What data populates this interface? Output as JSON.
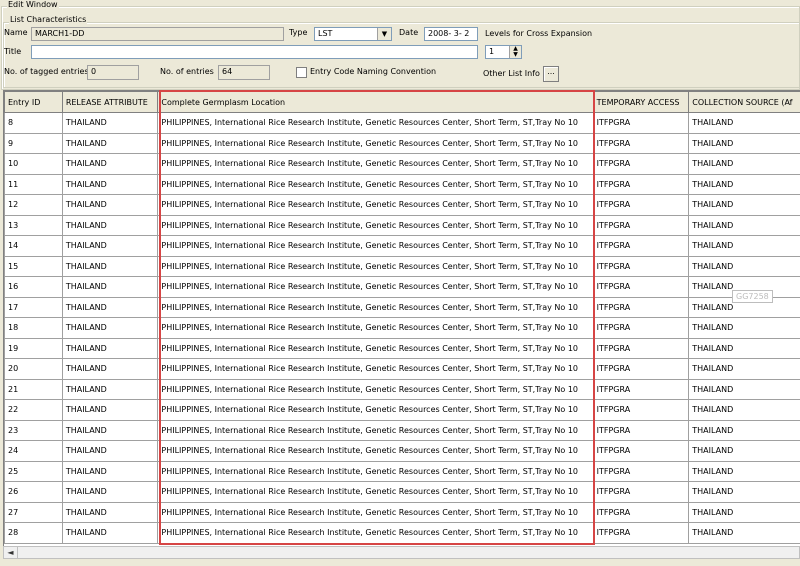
{
  "window": {
    "title": "Edit Window",
    "group_title": "List Characteristics"
  },
  "form": {
    "name_label": "Name",
    "name_value": "MARCH1-DD",
    "type_label": "Type",
    "type_value": "LST",
    "date_label": "Date",
    "date_value": "2008- 3- 2",
    "levels_label": "Levels for Cross Expansion",
    "levels_value": "1",
    "title_label": "Title",
    "title_value": "",
    "tagged_label": "No. of tagged entries",
    "tagged_value": "0",
    "entries_label": "No. of entries",
    "entries_value": "64",
    "naming_label": "Entry Code Naming Convention",
    "other_info_label": "Other List Info",
    "other_info_button": "..."
  },
  "table": {
    "columns": [
      "Entry ID",
      "RELEASE ATTRIBUTE",
      "Complete Germplasm Location",
      "TEMPORARY ACCESS",
      "COLLECTION SOURCE (Af"
    ],
    "rows": [
      [
        "8",
        "THAILAND",
        "PHILIPPINES, International Rice Research Institute, Genetic Resources Center, Short Term, ST,Tray No 10",
        "ITFPGRA",
        "THAILAND"
      ],
      [
        "9",
        "THAILAND",
        "PHILIPPINES, International Rice Research Institute, Genetic Resources Center, Short Term, ST,Tray No 10",
        "ITFPGRA",
        "THAILAND"
      ],
      [
        "10",
        "THAILAND",
        "PHILIPPINES, International Rice Research Institute, Genetic Resources Center, Short Term, ST,Tray No 10",
        "ITFPGRA",
        "THAILAND"
      ],
      [
        "11",
        "THAILAND",
        "PHILIPPINES, International Rice Research Institute, Genetic Resources Center, Short Term, ST,Tray No 10",
        "ITFPGRA",
        "THAILAND"
      ],
      [
        "12",
        "THAILAND",
        "PHILIPPINES, International Rice Research Institute, Genetic Resources Center, Short Term, ST,Tray No 10",
        "ITFPGRA",
        "THAILAND"
      ],
      [
        "13",
        "THAILAND",
        "PHILIPPINES, International Rice Research Institute, Genetic Resources Center, Short Term, ST,Tray No 10",
        "ITFPGRA",
        "THAILAND"
      ],
      [
        "14",
        "THAILAND",
        "PHILIPPINES, International Rice Research Institute, Genetic Resources Center, Short Term, ST,Tray No 10",
        "ITFPGRA",
        "THAILAND"
      ],
      [
        "15",
        "THAILAND",
        "PHILIPPINES, International Rice Research Institute, Genetic Resources Center, Short Term, ST,Tray No 10",
        "ITFPGRA",
        "THAILAND"
      ],
      [
        "16",
        "THAILAND",
        "PHILIPPINES, International Rice Research Institute, Genetic Resources Center, Short Term, ST,Tray No 10",
        "ITFPGRA",
        "THAILAND"
      ],
      [
        "17",
        "THAILAND",
        "PHILIPPINES, International Rice Research Institute, Genetic Resources Center, Short Term, ST,Tray No 10",
        "ITFPGRA",
        "THAILAND"
      ],
      [
        "18",
        "THAILAND",
        "PHILIPPINES, International Rice Research Institute, Genetic Resources Center, Short Term, ST,Tray No 10",
        "ITFPGRA",
        "THAILAND"
      ],
      [
        "19",
        "THAILAND",
        "PHILIPPINES, International Rice Research Institute, Genetic Resources Center, Short Term, ST,Tray No 10",
        "ITFPGRA",
        "THAILAND"
      ],
      [
        "20",
        "THAILAND",
        "PHILIPPINES, International Rice Research Institute, Genetic Resources Center, Short Term, ST,Tray No 10",
        "ITFPGRA",
        "THAILAND"
      ],
      [
        "21",
        "THAILAND",
        "PHILIPPINES, International Rice Research Institute, Genetic Resources Center, Short Term, ST,Tray No 10",
        "ITFPGRA",
        "THAILAND"
      ],
      [
        "22",
        "THAILAND",
        "PHILIPPINES, International Rice Research Institute, Genetic Resources Center, Short Term, ST,Tray No 10",
        "ITFPGRA",
        "THAILAND"
      ],
      [
        "23",
        "THAILAND",
        "PHILIPPINES, International Rice Research Institute, Genetic Resources Center, Short Term, ST,Tray No 10",
        "ITFPGRA",
        "THAILAND"
      ],
      [
        "24",
        "THAILAND",
        "PHILIPPINES, International Rice Research Institute, Genetic Resources Center, Short Term, ST,Tray No 10",
        "ITFPGRA",
        "THAILAND"
      ],
      [
        "25",
        "THAILAND",
        "PHILIPPINES, International Rice Research Institute, Genetic Resources Center, Short Term, ST,Tray No 10",
        "ITFPGRA",
        "THAILAND"
      ],
      [
        "26",
        "THAILAND",
        "PHILIPPINES, International Rice Research Institute, Genetic Resources Center, Short Term, ST,Tray No 10",
        "ITFPGRA",
        "THAILAND"
      ],
      [
        "27",
        "THAILAND",
        "PHILIPPINES, International Rice Research Institute, Genetic Resources Center, Short Term, ST,Tray No 10",
        "ITFPGRA",
        "THAILAND"
      ],
      [
        "28",
        "THAILAND",
        "PHILIPPINES, International Rice Research Institute, Genetic Resources Center, Short Term, ST,Tray No 10",
        "ITFPGRA",
        "THAILAND"
      ]
    ]
  },
  "tooltip": "GG7258",
  "highlight_color": "#d64545",
  "icons": {
    "dropdown": "chevron-down-icon",
    "spinner": "spinner-arrows-icon",
    "scroll_left": "scroll-left-arrow-icon"
  }
}
